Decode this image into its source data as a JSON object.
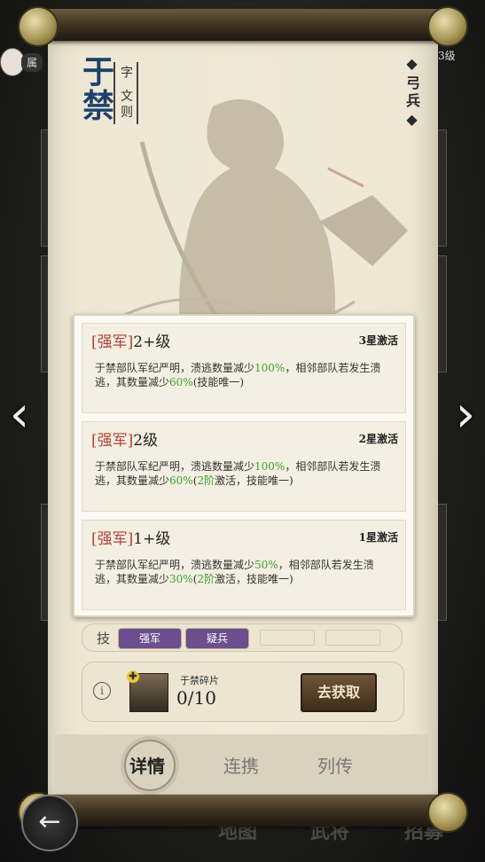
{
  "hero": {
    "name": "于禁",
    "courtesy": "字 文则",
    "unit_type": "◆弓兵◆"
  },
  "levels": [
    {
      "tag": "[强军]",
      "level": "2+级",
      "star": "3星激活",
      "desc_parts": [
        "于禁部队军纪严明，溃逃数量减少",
        "100%",
        "，相邻部队若发生溃逃，其数量减少",
        "60%",
        "(技能唯一)"
      ]
    },
    {
      "tag": "[强军]",
      "level": "2级",
      "star": "2星激活",
      "desc_parts": [
        "于禁部队军纪严明，溃逃数量减少",
        "100%",
        "，相邻部队若发生溃逃，其数量减少",
        "60%",
        "(",
        "2阶",
        "激活，技能唯一)"
      ]
    },
    {
      "tag": "[强军]",
      "level": "1+级",
      "star": "1星激活",
      "desc_parts": [
        "于禁部队军纪严明，溃逃数量减少",
        "50%",
        "，相邻部队若发生溃逃，其数量减少",
        "30%",
        "(",
        "2阶",
        "激活，技能唯一)"
      ]
    }
  ],
  "skills": {
    "label": "技",
    "items": [
      "强军",
      "疑兵"
    ]
  },
  "fragment": {
    "info_icon": "i",
    "name": "于禁碎片",
    "count": "0/10",
    "get_button": "去获取"
  },
  "tabs": [
    "详情",
    "连携",
    "列传"
  ],
  "active_tab": 0,
  "background_texts": {
    "top_left": "属",
    "top_right": "3级",
    "bottom": [
      "地图",
      "武将",
      "招募"
    ]
  },
  "icons": {
    "left_arrow": "left-chevron-icon",
    "right_arrow": "right-chevron-icon",
    "back": "back-arrow-icon"
  }
}
